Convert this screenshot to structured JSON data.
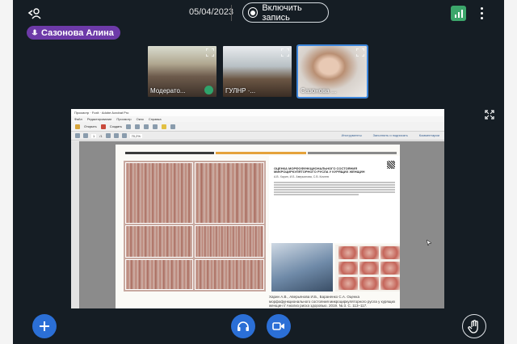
{
  "topbar": {
    "date": "05/04/2023",
    "record_label": "Включить запись"
  },
  "talker": {
    "name": "Сазонова Алина"
  },
  "videos": [
    {
      "name": "Модерато...",
      "active": false
    },
    {
      "name": "ГУЛНР ·...",
      "active": false
    },
    {
      "name": "Сазонова ...",
      "active": true
    }
  ],
  "shared_screen": {
    "app_title": "Просмотр · Foxit · Adobe Acrobat Pro",
    "menu": [
      "Файл",
      "Редактирование",
      "Просмотр",
      "Окно",
      "Справка"
    ],
    "toolbar": {
      "open_label": "Открыть",
      "create_label": "Создать",
      "page_current": "1",
      "page_total": "/1",
      "zoom": "70,2%",
      "right_links": [
        "Инструменты",
        "Заполнить и подписать",
        "Комментарии"
      ]
    },
    "slide": {
      "paper_title": "ОЦЕНКА МОРФОФУНКЦИОНАЛЬНОГО СОСТОЯНИЯ МИКРОЦИРКУЛЯТОРНОГО РУСЛА У КУРЯЩИХ ЖЕНЩИН",
      "paper_authors": "А.В. Харин, И.Б. Аверьянова, С.В. Кочнев",
      "caption": "Харин А.В., Аверьянова И.Б., Бараненко С.А. Оценка морфофункционального состояния микроциркуляторного русла у курящих женщин // Анализ риска здоровью. 2019. № 3. С. 113–117."
    }
  },
  "colors": {
    "background": "#151d24",
    "accent": "#2b6fd6",
    "talking": "#6d3aa8",
    "connection": "#3ca66b"
  }
}
